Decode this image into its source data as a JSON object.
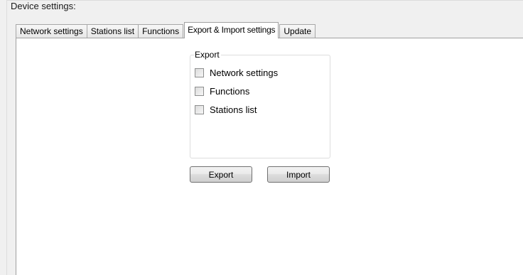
{
  "group": {
    "title": "Device settings:"
  },
  "tabs": [
    {
      "label": "Network settings",
      "active": false
    },
    {
      "label": "Stations list",
      "active": false
    },
    {
      "label": "Functions",
      "active": false
    },
    {
      "label": "Export & Import settings",
      "active": true
    },
    {
      "label": "Update",
      "active": false
    }
  ],
  "export_group": {
    "legend": "Export",
    "options": [
      {
        "label": "Network settings",
        "checked": false
      },
      {
        "label": "Functions",
        "checked": false
      },
      {
        "label": "Stations list",
        "checked": false
      }
    ]
  },
  "buttons": {
    "export_label": "Export",
    "import_label": "Import"
  }
}
